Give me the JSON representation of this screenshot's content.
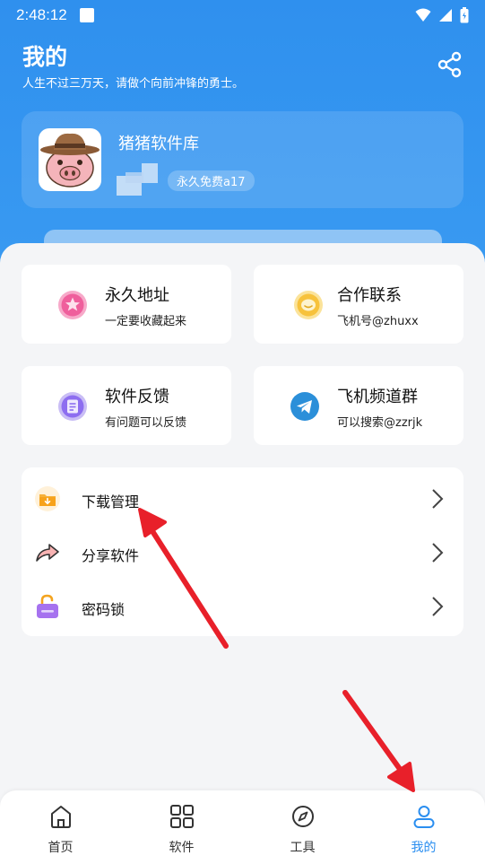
{
  "status_bar": {
    "time": "2:48:12"
  },
  "header": {
    "title": "我的",
    "subtitle": "人生不过三万天，请做个向前冲锋的勇士。"
  },
  "profile": {
    "name": "猪猪软件库",
    "badge": "永久免费a17"
  },
  "tiles": [
    {
      "title": "永久地址",
      "subtitle": "一定要收藏起来",
      "icon": "star-icon"
    },
    {
      "title": "合作联系",
      "subtitle": "飞机号@zhuxx",
      "icon": "chat-bubble-icon"
    },
    {
      "title": "软件反馈",
      "subtitle": "有问题可以反馈",
      "icon": "feedback-doc-icon"
    },
    {
      "title": "飞机频道群",
      "subtitle": "可以搜索@zzrjk",
      "icon": "telegram-icon"
    }
  ],
  "list": [
    {
      "label": "下载管理",
      "icon": "download-folder-icon"
    },
    {
      "label": "分享软件",
      "icon": "share-arrow-icon"
    },
    {
      "label": "密码锁",
      "icon": "unlock-icon"
    }
  ],
  "nav": [
    {
      "label": "首页",
      "icon": "home-icon"
    },
    {
      "label": "软件",
      "icon": "grid-icon"
    },
    {
      "label": "工具",
      "icon": "compass-icon"
    },
    {
      "label": "我的",
      "icon": "user-icon",
      "active": true
    }
  ],
  "colors": {
    "header_blue": "#2f90ee",
    "active_nav": "#2a8ef0",
    "annotation_red": "#e8202a"
  }
}
